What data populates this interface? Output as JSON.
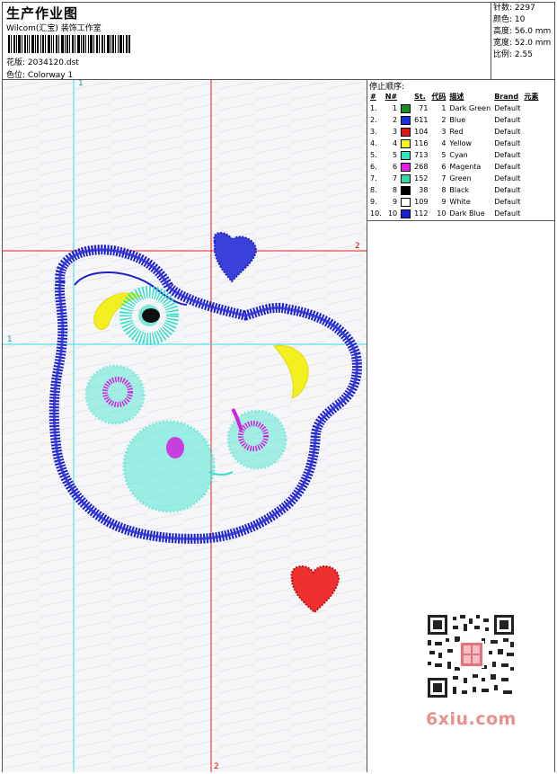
{
  "header": {
    "title": "生产作业图",
    "studio": "Wilcom(汇宝) 装饰工作室",
    "pattern_label": "花版:",
    "pattern_file": "2034120.dst",
    "colorway_label": "色位:",
    "colorway": "Colorway 1"
  },
  "stats": {
    "stitches": "针数: 2297",
    "colors": "颜色: 10",
    "height": "高度: 56.0 mm",
    "width": "宽度: 52.0 mm",
    "scale": "比例: 2.55"
  },
  "guides": {
    "vertical_cyan": "1",
    "vertical_red": "2",
    "horizontal_red": "2",
    "horizontal_cyan": "1"
  },
  "stop_sequence": {
    "title": "停止顺序:",
    "columns": [
      "#",
      "N#",
      "St.",
      "代码",
      "描述",
      "Brand",
      "元素"
    ],
    "rows": [
      {
        "n": "1.",
        "nn": "1",
        "color": "#15901a",
        "st": "71",
        "code": "1",
        "desc": "Dark Green",
        "brand": "Default"
      },
      {
        "n": "2.",
        "nn": "2",
        "color": "#1a2ee8",
        "st": "611",
        "code": "2",
        "desc": "Blue",
        "brand": "Default"
      },
      {
        "n": "3.",
        "nn": "3",
        "color": "#e41212",
        "st": "104",
        "code": "3",
        "desc": "Red",
        "brand": "Default"
      },
      {
        "n": "4.",
        "nn": "4",
        "color": "#f5f516",
        "st": "116",
        "code": "4",
        "desc": "Yellow",
        "brand": "Default"
      },
      {
        "n": "5.",
        "nn": "5",
        "color": "#28e8c8",
        "st": "713",
        "code": "5",
        "desc": "Cyan",
        "brand": "Default"
      },
      {
        "n": "6.",
        "nn": "6",
        "color": "#e61ee6",
        "st": "268",
        "code": "6",
        "desc": "Magenta",
        "brand": "Default"
      },
      {
        "n": "7.",
        "nn": "7",
        "color": "#2ed8a8",
        "st": "152",
        "code": "7",
        "desc": "Green",
        "brand": "Default"
      },
      {
        "n": "8.",
        "nn": "8",
        "color": "#000000",
        "st": "38",
        "code": "8",
        "desc": "Black",
        "brand": "Default"
      },
      {
        "n": "9.",
        "nn": "9",
        "color": "#ffffff",
        "st": "109",
        "code": "9",
        "desc": "White",
        "brand": "Default"
      },
      {
        "n": "10.",
        "nn": "10",
        "color": "#1a22d8",
        "st": "112",
        "code": "10",
        "desc": "Dark Blue",
        "brand": "Default"
      }
    ]
  },
  "watermark": "6xiu.com",
  "colors": {
    "guide_cyan": "#2ee0e0",
    "guide_red": "#e02020",
    "outline_blue": "#1c20c8",
    "fill_cyan": "#30e0c8",
    "magenta": "#d020e0",
    "yellow": "#f4f020",
    "red_heart": "#e01818"
  }
}
